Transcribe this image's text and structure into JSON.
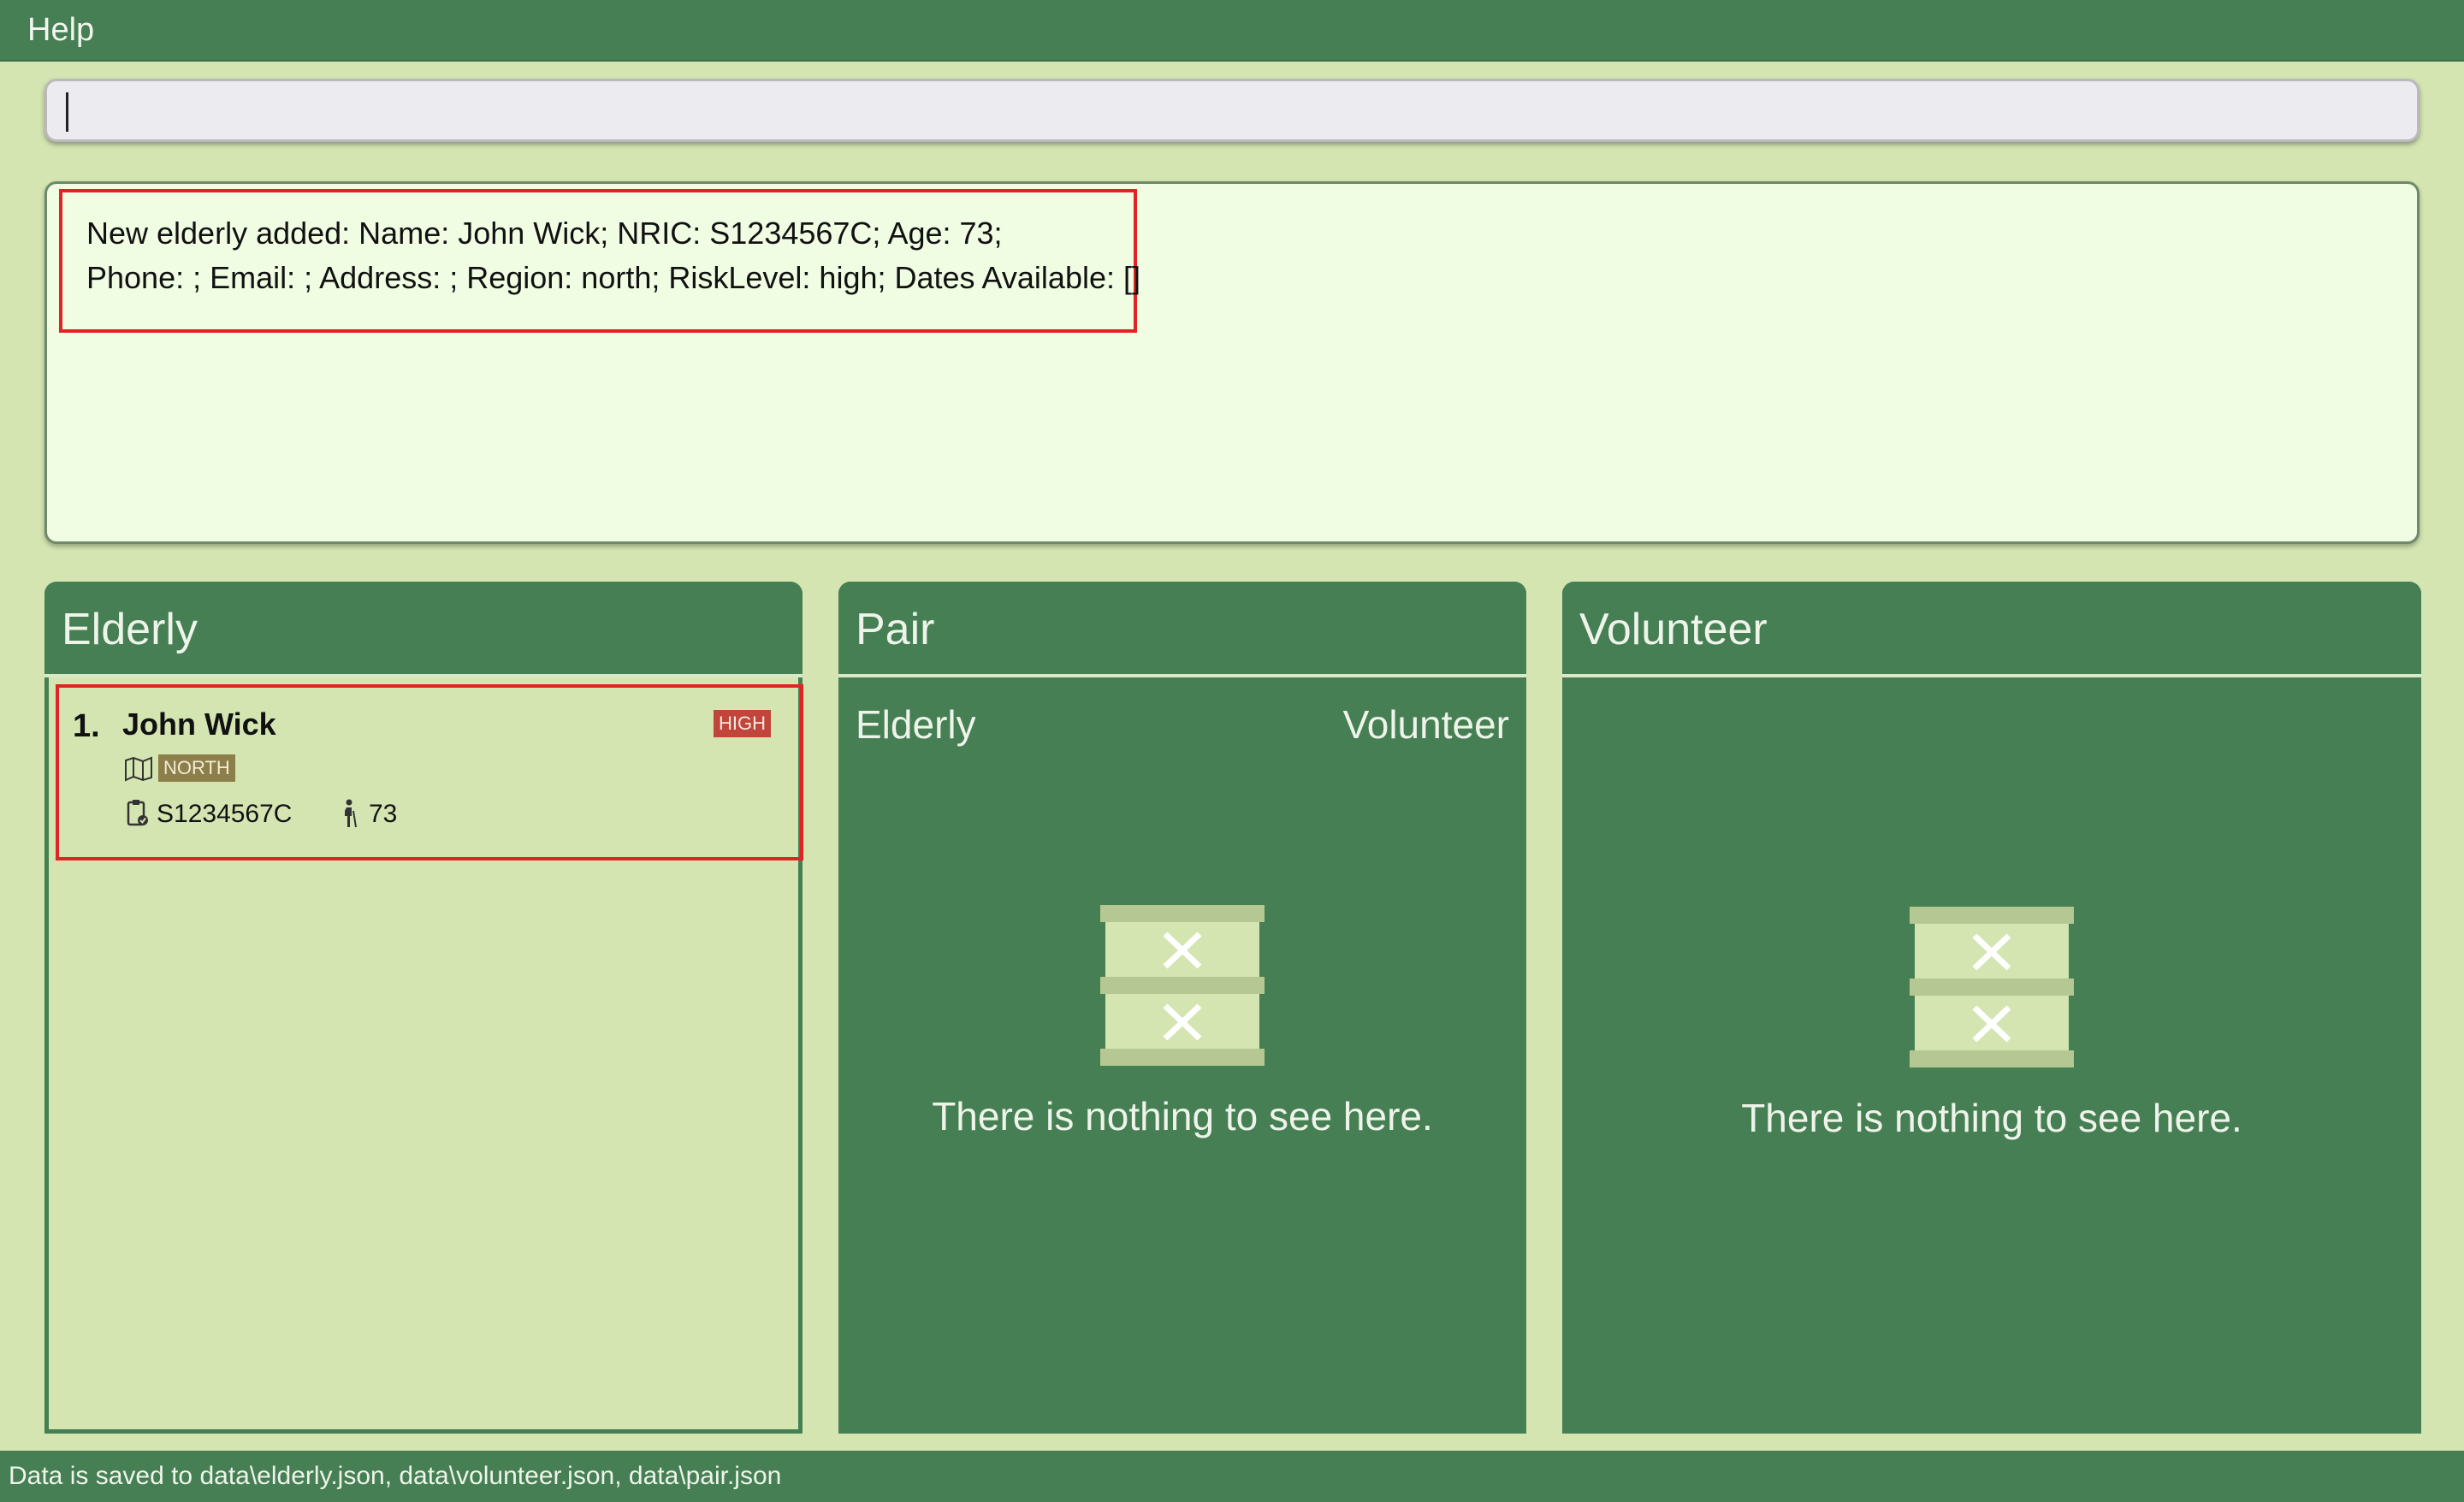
{
  "menubar": {
    "help_label": "Help"
  },
  "command_box": {
    "value": "",
    "placeholder": ""
  },
  "result_display": {
    "lines": [
      "New elderly added: Name: John Wick; NRIC: S1234567C; Age: 73;",
      "Phone: ; Email: ; Address: ; Region: north; RiskLevel: high; Dates Available: []"
    ]
  },
  "elderly_panel": {
    "title": "Elderly",
    "items": [
      {
        "index": "1.",
        "name": "John Wick",
        "risk": "HIGH",
        "region": "NORTH",
        "nric": "S1234567C",
        "age": "73"
      }
    ]
  },
  "pair_panel": {
    "title": "Pair",
    "col_left": "Elderly",
    "col_right": "Volunteer",
    "empty_message": "There is nothing to see here."
  },
  "volunteer_panel": {
    "title": "Volunteer",
    "empty_message": "There is nothing to see here."
  },
  "status_bar": {
    "text": "Data is saved to data\\elderly.json, data\\volunteer.json, data\\pair.json"
  },
  "colors": {
    "primary_green": "#467f53",
    "background": "#d4e5b2",
    "result_bg": "#f0fde3",
    "highlight_red": "#e02424",
    "risk_high": "#c2453b",
    "region_tag": "#8d7f4c"
  },
  "icons": [
    "map-icon",
    "id-card-icon",
    "person-icon",
    "empty-box-icon"
  ]
}
